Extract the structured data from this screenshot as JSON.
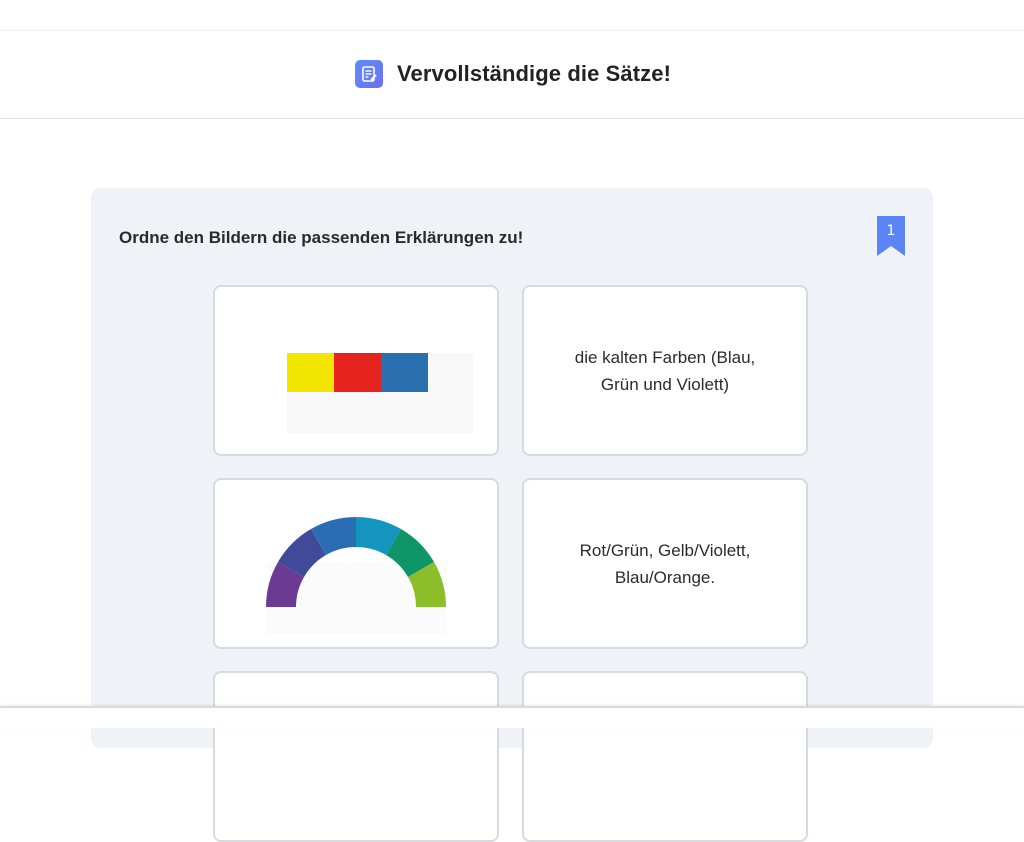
{
  "header": {
    "title": "Vervollständige die Sätze!",
    "icon": "document-edit-icon"
  },
  "exercise": {
    "instruction": "Ordne den Bildern die passenden Erklärungen zu!",
    "number": "1",
    "accent_color": "#5b85f5",
    "cards": [
      {
        "type": "image",
        "image": "primary-colors-strip",
        "colors": [
          "#f2e500",
          "#e52420",
          "#2a70b1"
        ]
      },
      {
        "type": "text",
        "text_lines": [
          "die kalten Farben (Blau,",
          "Grün und Violett)"
        ]
      },
      {
        "type": "image",
        "image": "color-wheel-half-arc",
        "colors": [
          "#6b3a92",
          "#3f4a9a",
          "#2a6db3",
          "#1395bf",
          "#0f9668",
          "#8cbe2a"
        ]
      },
      {
        "type": "text",
        "text_lines": [
          "Rot/Grün, Gelb/Violett,",
          "Blau/Orange."
        ]
      }
    ]
  }
}
